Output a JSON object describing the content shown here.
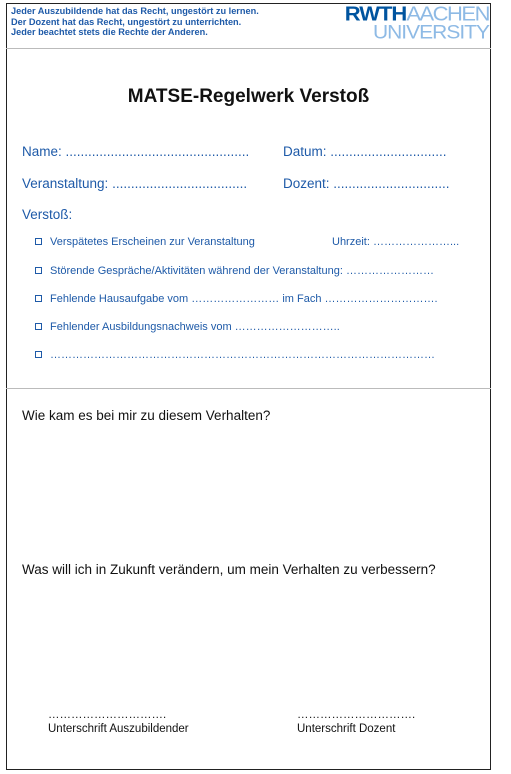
{
  "header": {
    "rules": [
      "Jeder Auszubildende hat das Recht, ungestört zu lernen.",
      "Der Dozent hat das Recht, ungestört zu unterrichten.",
      "Jeder beachtet stets die Rechte der Anderen."
    ],
    "logo": {
      "strong": "RWTH",
      "light": "AACHEN",
      "line2": "UNIVERSITY"
    }
  },
  "title": "MATSE-Regelwerk Verstoß",
  "fields": {
    "name": "Name: .................................................",
    "datum": "Datum: ...............................",
    "veranstaltung": "Veranstaltung: ....................................",
    "dozent": "Dozent: ...............................",
    "verstoss": "Verstoß:"
  },
  "violations": [
    {
      "text": "Verspätetes Erscheinen zur Veranstaltung",
      "extra": "Uhrzeit: …………………..."
    },
    {
      "text": "Störende Gespräche/Aktivitäten während der Veranstaltung: ……………………"
    },
    {
      "text": "Fehlende Hausaufgabe vom …………………… im Fach …………………………."
    },
    {
      "text": "Fehlender Ausbildungsnachweis vom ……………………….."
    },
    {
      "text": "……………………………………………………………………………………………"
    }
  ],
  "questions": {
    "q1": "Wie kam es bei mir zu diesem Verhalten?",
    "q2": "Was will ich in Zukunft verändern, um mein Verhalten zu verbessern?"
  },
  "signatures": {
    "left_dots": "………………………….",
    "left_label": "Unterschrift Auszubildender",
    "right_dots": "………………………….",
    "right_label": "Unterschrift Dozent"
  },
  "colors": {
    "accent": "#1e5aa8",
    "logo_dark": "#00549f",
    "logo_light": "#8ebae5"
  }
}
